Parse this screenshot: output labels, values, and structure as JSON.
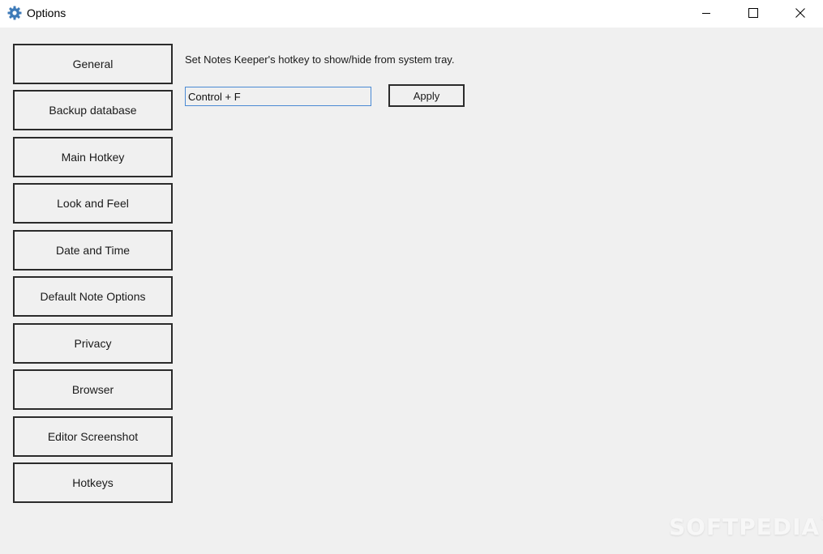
{
  "window": {
    "title": "Options",
    "icon": "gear-icon",
    "controls": [
      "minimize",
      "maximize",
      "close"
    ]
  },
  "sidebar": {
    "items": [
      {
        "label": "General"
      },
      {
        "label": "Backup database"
      },
      {
        "label": "Main Hotkey"
      },
      {
        "label": "Look and Feel"
      },
      {
        "label": "Date and Time"
      },
      {
        "label": "Default Note Options"
      },
      {
        "label": "Privacy"
      },
      {
        "label": "Browser"
      },
      {
        "label": "Editor Screenshot"
      },
      {
        "label": "Hotkeys"
      }
    ]
  },
  "main": {
    "description": "Set Notes Keeper's hotkey to show/hide from system tray.",
    "hotkey_value": "Control + F",
    "apply_label": "Apply"
  },
  "watermark": {
    "text": "SOFTPEDIA",
    "mark": "®"
  },
  "colors": {
    "input_focus_border": "#4a8ad4",
    "icon_blue": "#3d7ab8",
    "background": "#f0f0f0"
  }
}
